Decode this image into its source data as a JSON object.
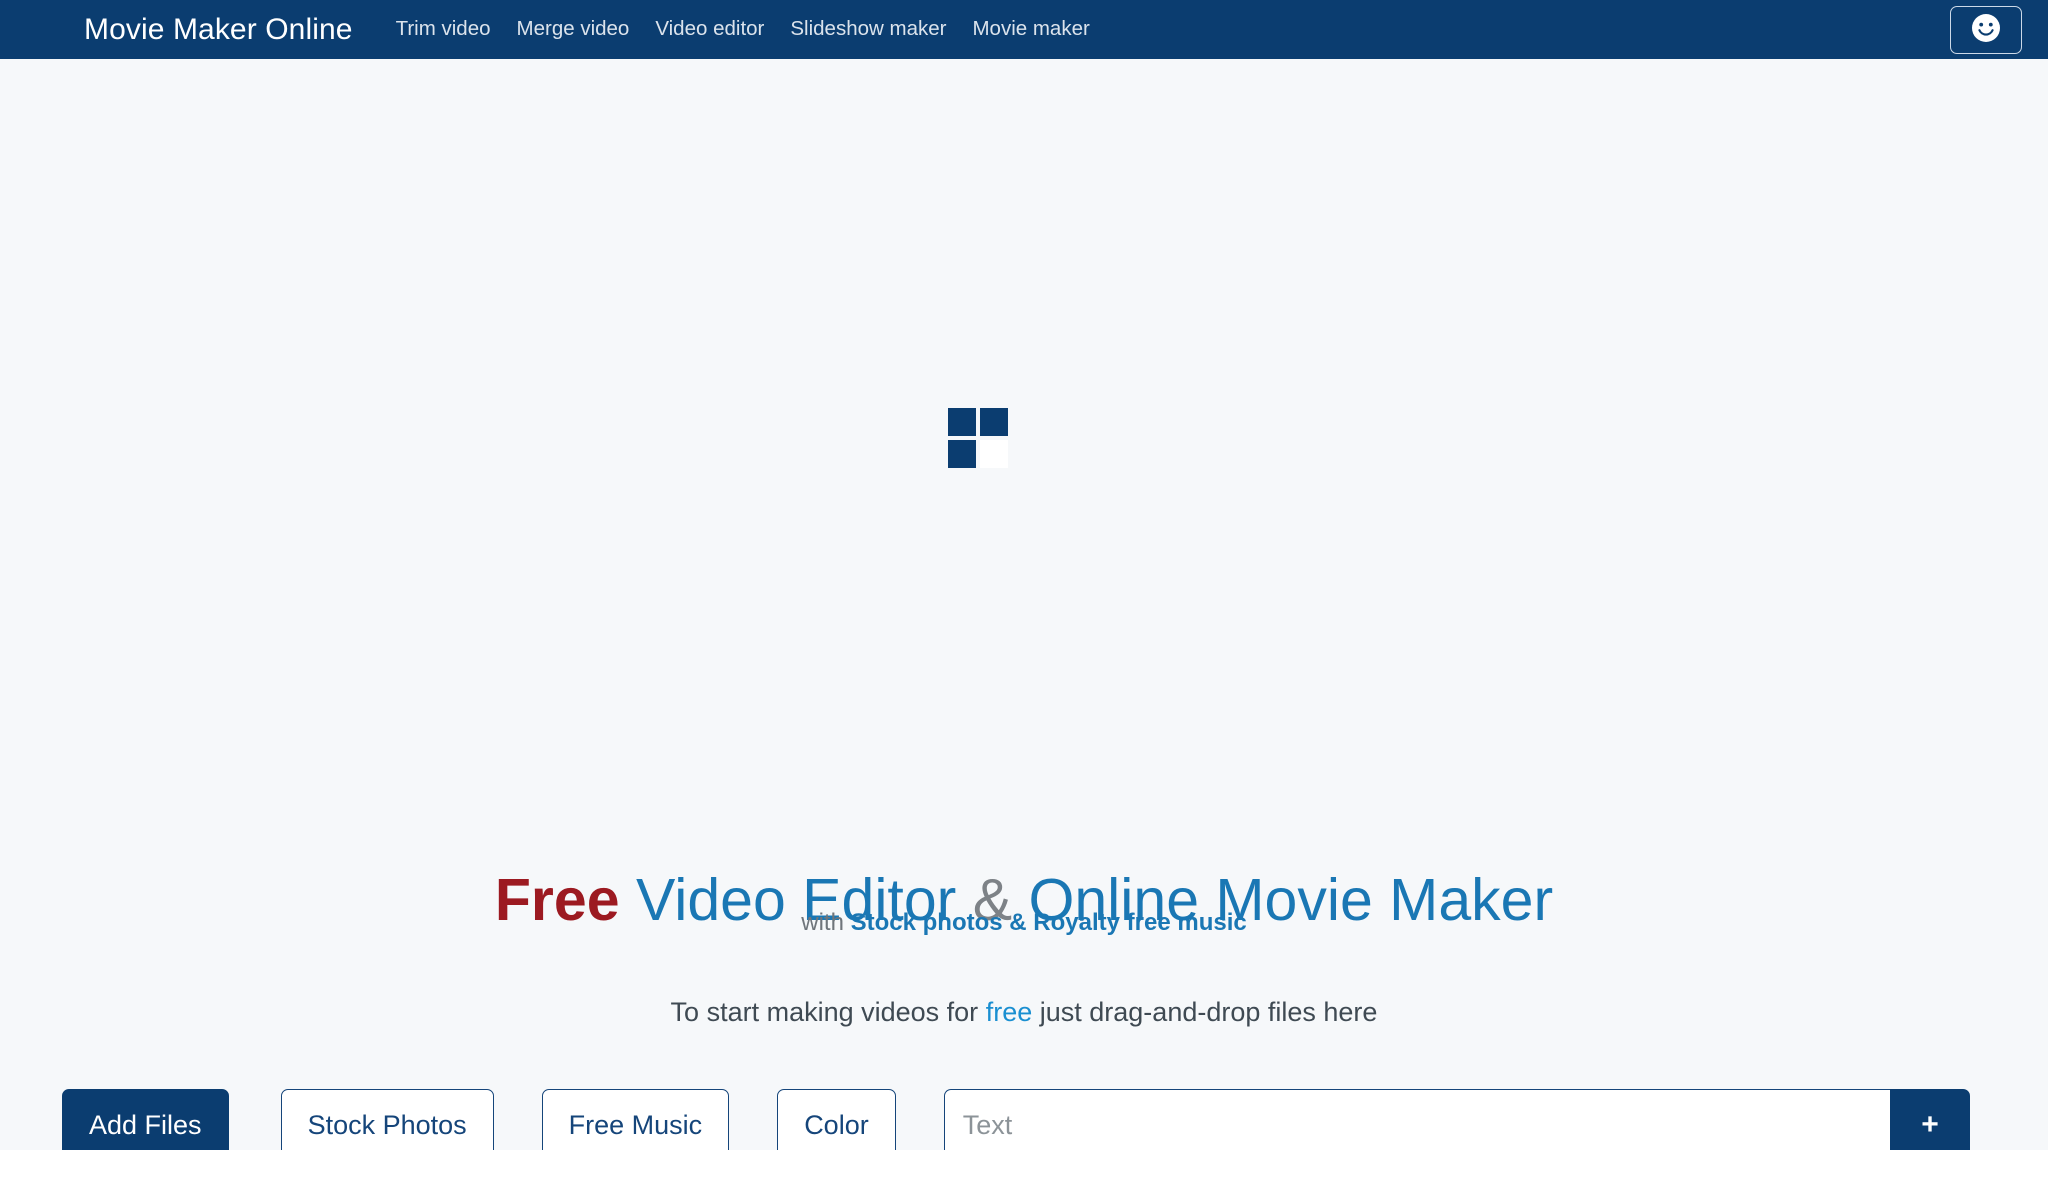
{
  "header": {
    "brand": "Movie Maker Online",
    "nav_items": [
      {
        "label": "Trim video"
      },
      {
        "label": "Merge video"
      },
      {
        "label": "Video editor"
      },
      {
        "label": "Slideshow maker"
      },
      {
        "label": "Movie maker"
      }
    ],
    "account_button": {
      "icon": "smiley-face-icon",
      "label": ""
    },
    "colors": {
      "background": "#0b3d70",
      "brand_text": "#ffffff",
      "nav_text": "#dbe3ec"
    }
  },
  "stage": {
    "background": "#f6f8fa",
    "loader": {
      "name": "loading-squares-icon",
      "filled_color": "#0b3d70",
      "empty_color": "#ffffff"
    },
    "headline": {
      "part_free": "Free",
      "part_video_editor": "Video Editor",
      "part_amp": "&",
      "part_online_movie_maker": "Online Movie Maker",
      "color_free": "#9c1a21",
      "color_blue": "#1a77b4",
      "color_amp": "#7d8287"
    },
    "subtitle": {
      "prefix": "with",
      "highlight": "Stock photos & Royalty free music",
      "color_prefix": "#6f757b",
      "color_highlight": "#1a77b4"
    },
    "dropline": {
      "before": "To start making videos for",
      "highlight": "free",
      "after": "just drag-and-drop files here",
      "color_highlight": "#1a8fd1",
      "color_text": "#3f4a53"
    }
  },
  "actionbar": {
    "add_files_label": "Add Files",
    "stock_photos_label": "Stock Photos",
    "free_music_label": "Free Music",
    "color_label": "Color",
    "text_input": {
      "value": "",
      "placeholder": "Text"
    },
    "add_text_button_label": "+",
    "colors": {
      "primary": "#0b3d70",
      "outline_border": "#15457a",
      "outline_text": "#15457a"
    }
  }
}
